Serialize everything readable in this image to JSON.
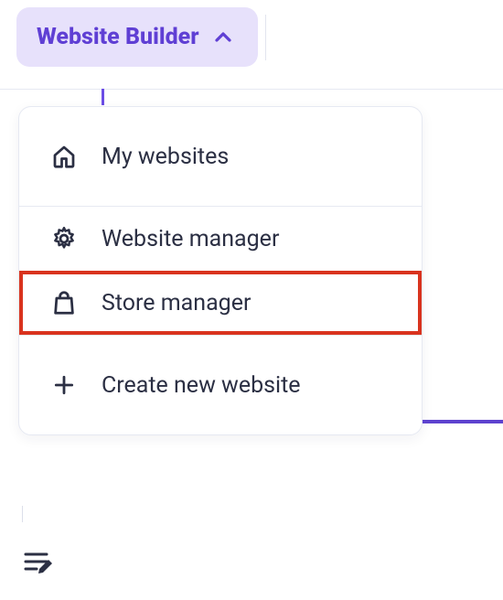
{
  "topbar": {
    "title": "Website Builder"
  },
  "dropdown": {
    "sections": [
      {
        "items": [
          {
            "icon": "home-icon",
            "label": "My websites"
          }
        ]
      },
      {
        "items": [
          {
            "icon": "gear-icon",
            "label": "Website manager"
          },
          {
            "icon": "bag-icon",
            "label": "Store manager",
            "highlighted": true
          }
        ]
      },
      {
        "items": [
          {
            "icon": "plus-icon",
            "label": "Create new website"
          }
        ]
      }
    ]
  },
  "colors": {
    "accent": "#6b4de6",
    "pillBg": "#e7e1fb",
    "highlight": "#d9331e",
    "text": "#2b2f43"
  }
}
